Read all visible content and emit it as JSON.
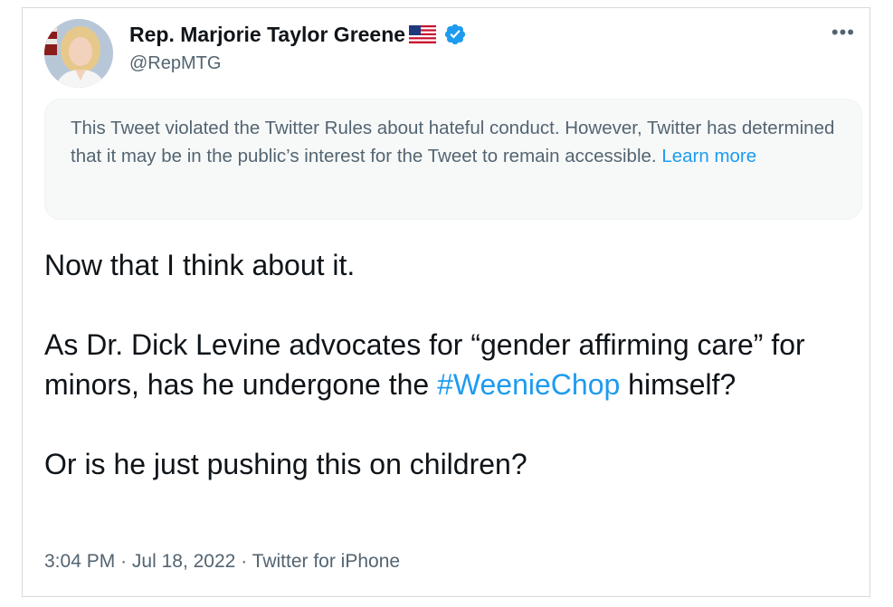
{
  "author": {
    "name": "Rep. Marjorie Taylor Greene",
    "handle": "@RepMTG",
    "flag_icon": "us-flag-emoji",
    "verified_icon": "verified-badge-icon"
  },
  "menu": {
    "more_label": "•••"
  },
  "notice": {
    "text": "This Tweet violated the Twitter Rules about hateful conduct. However, Twitter has determined that it may be in the public’s interest for the Tweet to remain accessible.",
    "link_label": "Learn more"
  },
  "tweet": {
    "line1": "Now that I think about it.",
    "line2_before": "As Dr. Dick Levine advocates for “gender affirming care” for minors, has he undergone the",
    "hashtag": "#WeenieChop",
    "line2_after": "himself?",
    "line3": "Or is he just pushing this on children?"
  },
  "meta": {
    "time": "3:04 PM",
    "date": "Jul 18, 2022",
    "source": "Twitter for iPhone",
    "separator": "·"
  },
  "colors": {
    "accent": "#1d9bf0",
    "text": "#0f1419",
    "secondary": "#536471",
    "notice_bg": "#f7f9f9"
  }
}
